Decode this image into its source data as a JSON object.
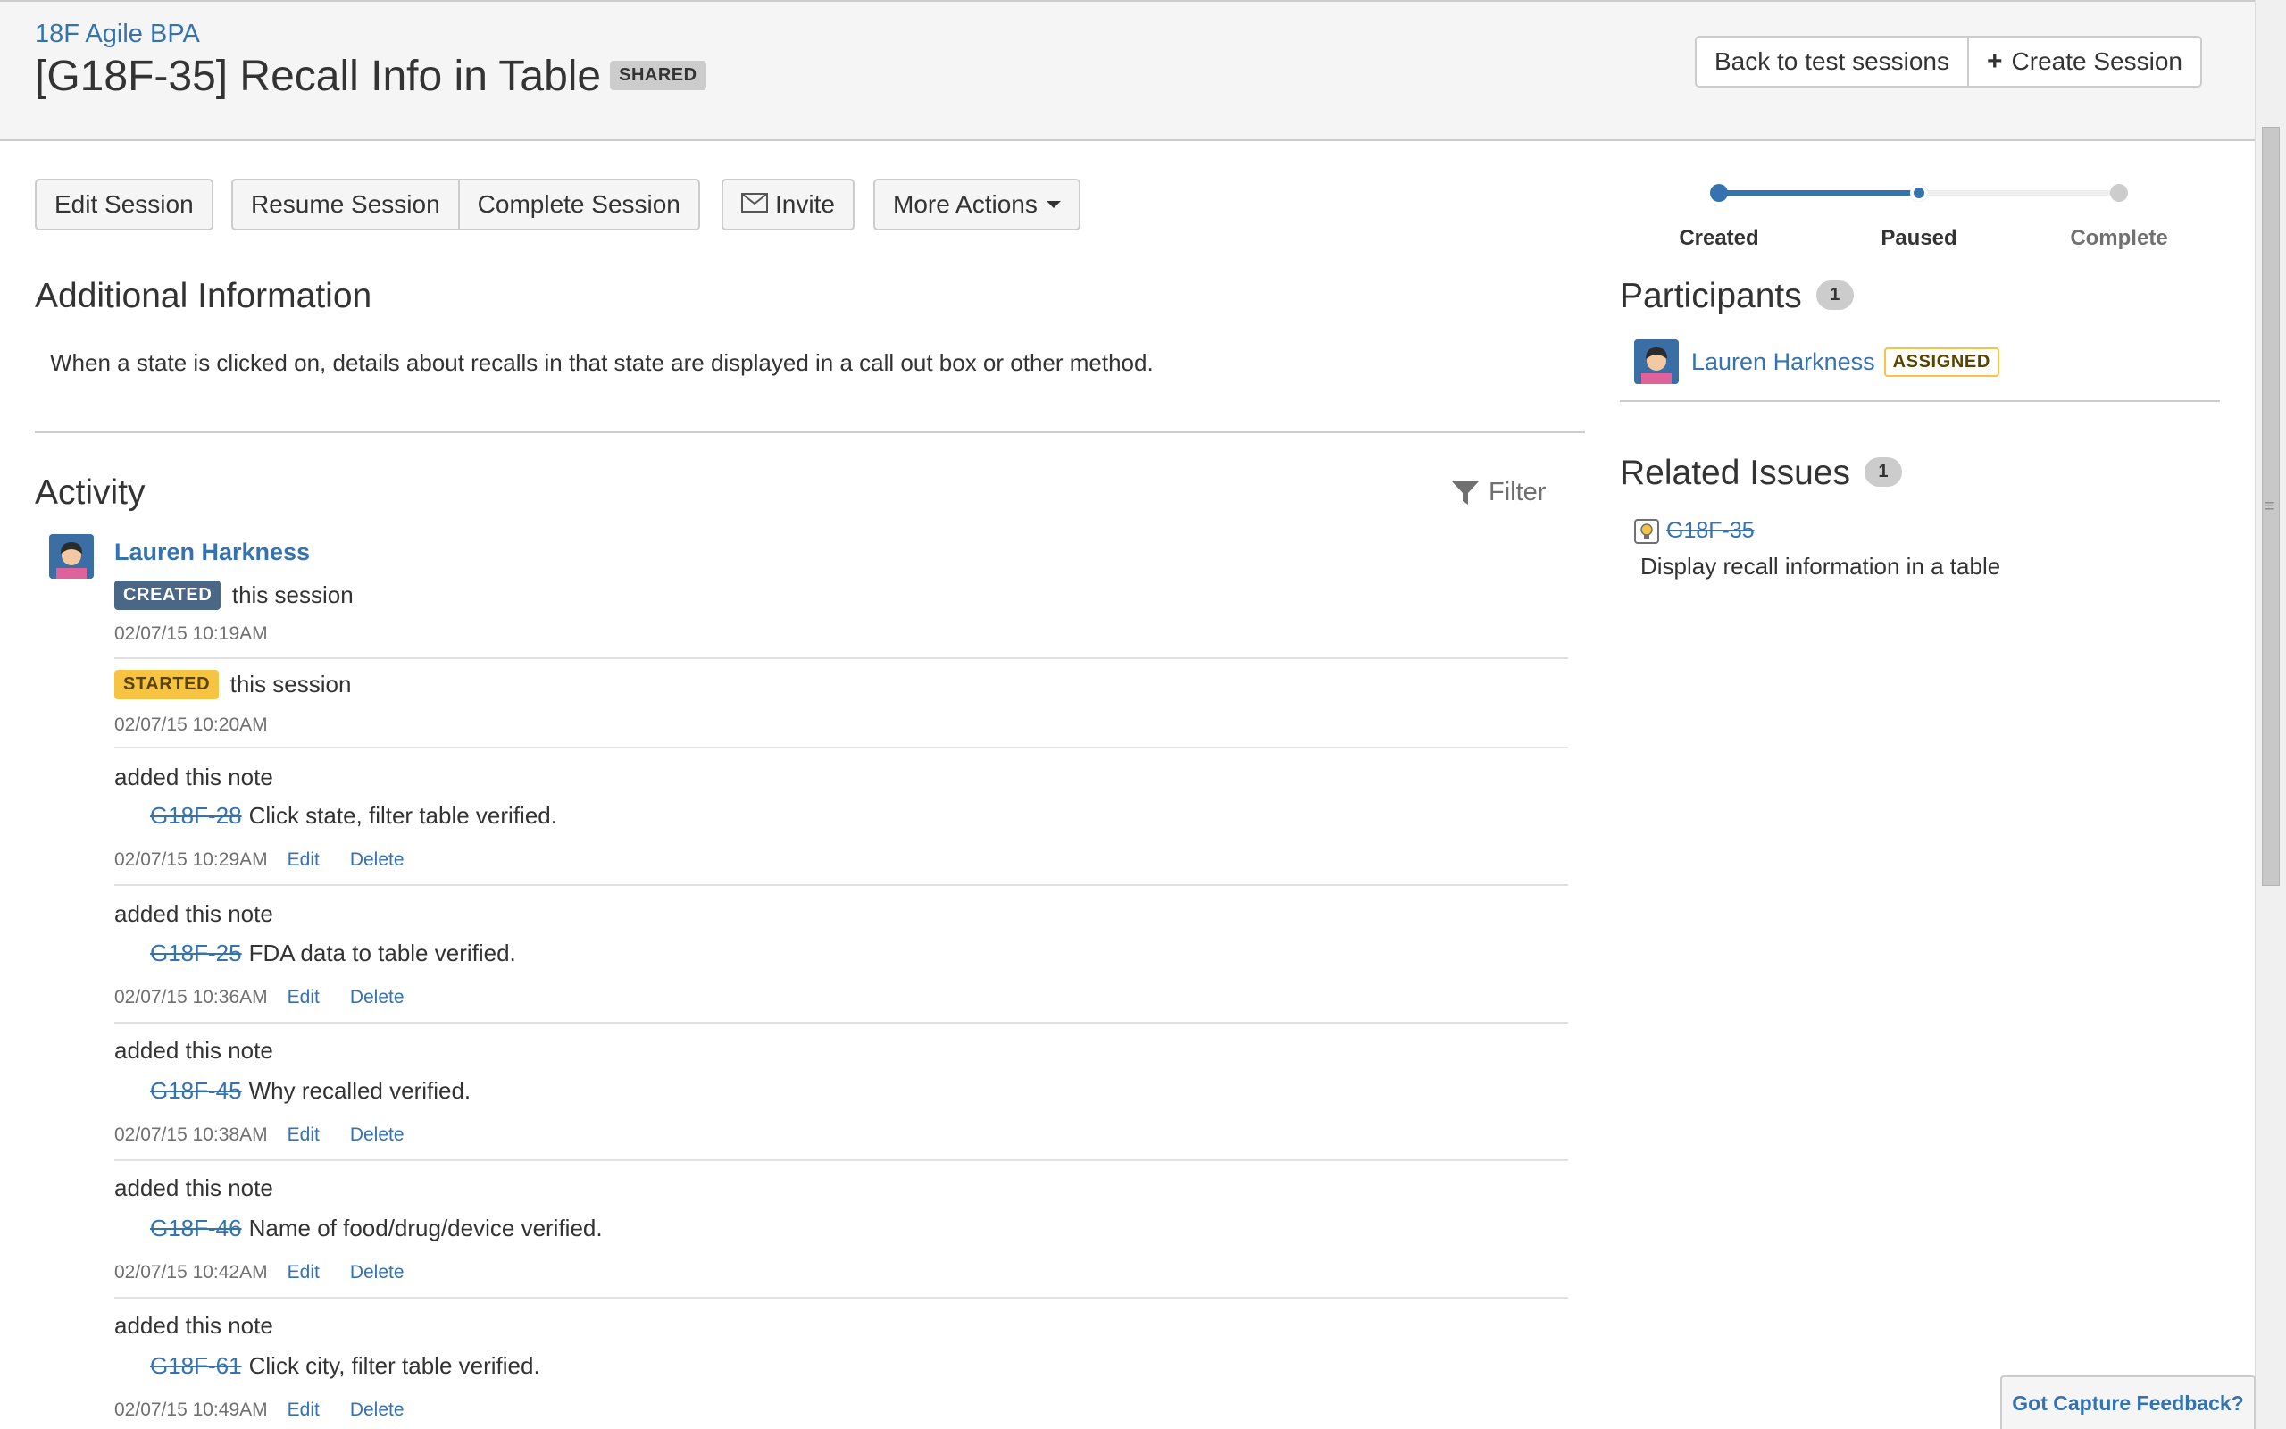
{
  "header": {
    "project_link": "18F Agile BPA",
    "title": "[G18F-35] Recall Info in Table",
    "shared_label": "SHARED",
    "back_button": "Back to test sessions",
    "create_button": "Create Session"
  },
  "toolbar": {
    "edit": "Edit Session",
    "resume": "Resume Session",
    "complete": "Complete Session",
    "invite": "Invite",
    "more_actions": "More Actions"
  },
  "tracker": {
    "steps": [
      "Created",
      "Paused",
      "Complete"
    ],
    "current_step": "Paused"
  },
  "additional_info": {
    "heading": "Additional Information",
    "text": "When a state is clicked on, details about recalls in that state are displayed in a call out box or other method."
  },
  "activity": {
    "heading": "Activity",
    "filter_label": "Filter",
    "author": "Lauren Harkness",
    "events": [
      {
        "badge": "CREATED",
        "text": "this session",
        "time": "02/07/15 10:19AM"
      },
      {
        "badge": "STARTED",
        "text": "this session",
        "time": "02/07/15 10:20AM"
      }
    ],
    "notes": [
      {
        "header": "added this note",
        "issue": "G18F-28",
        "text": "Click state, filter table verified.",
        "time": "02/07/15 10:29AM",
        "edit": "Edit",
        "delete": "Delete"
      },
      {
        "header": "added this note",
        "issue": "G18F-25",
        "text": "FDA data to table verified.",
        "time": "02/07/15 10:36AM",
        "edit": "Edit",
        "delete": "Delete"
      },
      {
        "header": "added this note",
        "issue": "G18F-45",
        "text": "Why recalled verified.",
        "time": "02/07/15 10:38AM",
        "edit": "Edit",
        "delete": "Delete"
      },
      {
        "header": "added this note",
        "issue": "G18F-46",
        "text": "Name of food/drug/device verified.",
        "time": "02/07/15 10:42AM",
        "edit": "Edit",
        "delete": "Delete"
      },
      {
        "header": "added this note",
        "issue": "G18F-61",
        "text": "Click city, filter table verified.",
        "time": "02/07/15 10:49AM",
        "edit": "Edit",
        "delete": "Delete"
      }
    ]
  },
  "participants": {
    "heading": "Participants",
    "count": "1",
    "name": "Lauren Harkness",
    "role": "ASSIGNED"
  },
  "related_issues": {
    "heading": "Related Issues",
    "count": "1",
    "key": "G18F-35",
    "summary": "Display recall information in a table"
  },
  "feedback": "Got Capture Feedback?",
  "colors": {
    "link": "#3572b0",
    "tracker_active": "#3572b0",
    "tracker_inactive": "#cccccc",
    "created_lozenge": "#4a6785",
    "started_lozenge": "#f6c342"
  }
}
